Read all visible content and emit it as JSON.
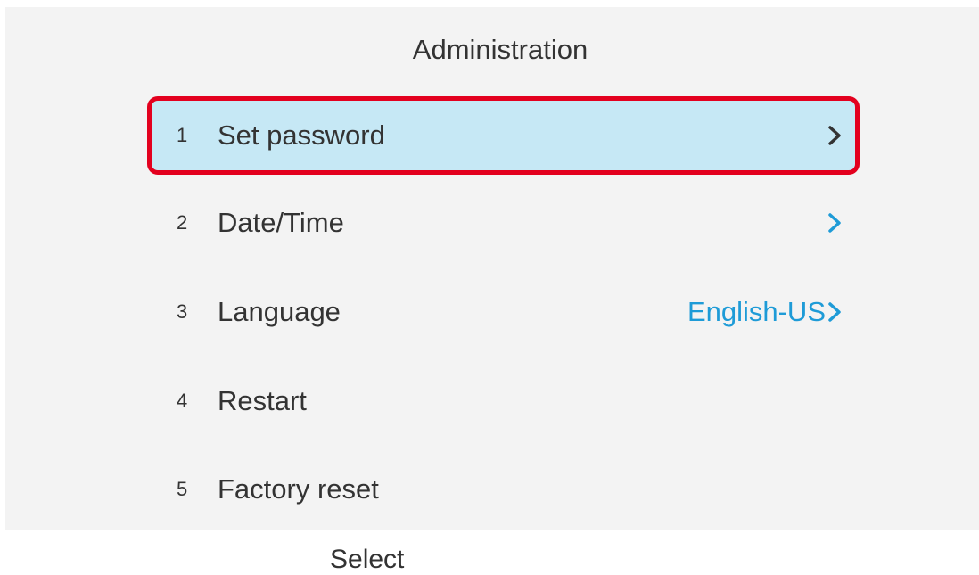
{
  "header": {
    "title": "Administration"
  },
  "menu": {
    "items": [
      {
        "number": "1",
        "label": "Set password",
        "value": "",
        "selected": true
      },
      {
        "number": "2",
        "label": "Date/Time",
        "value": ""
      },
      {
        "number": "3",
        "label": "Language",
        "value": "English-US"
      },
      {
        "number": "4",
        "label": "Restart",
        "value": ""
      },
      {
        "number": "5",
        "label": "Factory reset",
        "value": ""
      }
    ]
  },
  "softkeys": {
    "select_label": "Select"
  },
  "colors": {
    "selected_bg": "#c6e8f5",
    "highlight_border": "#e3001e",
    "accent": "#1e9bd7",
    "screen_bg": "#f3f3f3"
  },
  "icons": {
    "chevron": "chevron-right-icon"
  }
}
